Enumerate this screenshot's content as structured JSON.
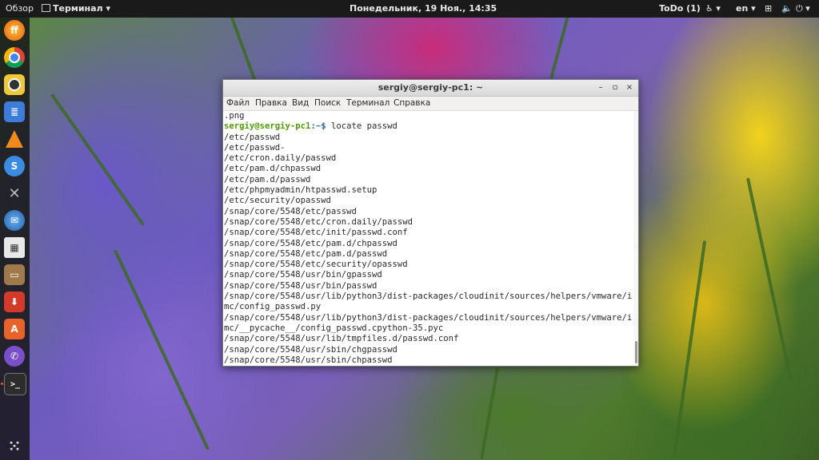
{
  "topbar": {
    "overview": "Обзор",
    "app_menu": "Терминал",
    "clock": "Понедельник, 19 Ноя., 14:35",
    "todo": "ToDo (1)",
    "lang": "en"
  },
  "dock": {
    "apps": [
      "firefox",
      "chrome",
      "rhythmbox",
      "files",
      "vlc",
      "simplenote",
      "tools",
      "thunderbird",
      "calculator",
      "file-manager",
      "downloader",
      "app-center",
      "viber",
      "terminal",
      "show-apps"
    ]
  },
  "terminal": {
    "title": "sergiy@sergiy-pc1: ~",
    "menu": [
      "Файл",
      "Правка",
      "Вид",
      "Поиск",
      "Терминал",
      "Справка"
    ],
    "prompt_user": "sergiy@sergiy-pc1",
    "prompt_path": ":~$ ",
    "command": "locate passwd",
    "first_line": ".png",
    "output": [
      "/etc/passwd",
      "/etc/passwd-",
      "/etc/cron.daily/passwd",
      "/etc/pam.d/chpasswd",
      "/etc/pam.d/passwd",
      "/etc/phpmyadmin/htpasswd.setup",
      "/etc/security/opasswd",
      "/snap/core/5548/etc/passwd",
      "/snap/core/5548/etc/cron.daily/passwd",
      "/snap/core/5548/etc/init/passwd.conf",
      "/snap/core/5548/etc/pam.d/chpasswd",
      "/snap/core/5548/etc/pam.d/passwd",
      "/snap/core/5548/etc/security/opasswd",
      "/snap/core/5548/usr/bin/gpasswd",
      "/snap/core/5548/usr/bin/passwd",
      "/snap/core/5548/usr/lib/python3/dist-packages/cloudinit/sources/helpers/vmware/i",
      "mc/config_passwd.py",
      "/snap/core/5548/usr/lib/python3/dist-packages/cloudinit/sources/helpers/vmware/i",
      "mc/__pycache__/config_passwd.cpython-35.pyc",
      "/snap/core/5548/usr/lib/tmpfiles.d/passwd.conf",
      "/snap/core/5548/usr/sbin/chgpasswd",
      "/snap/core/5548/usr/sbin/chpasswd"
    ]
  }
}
